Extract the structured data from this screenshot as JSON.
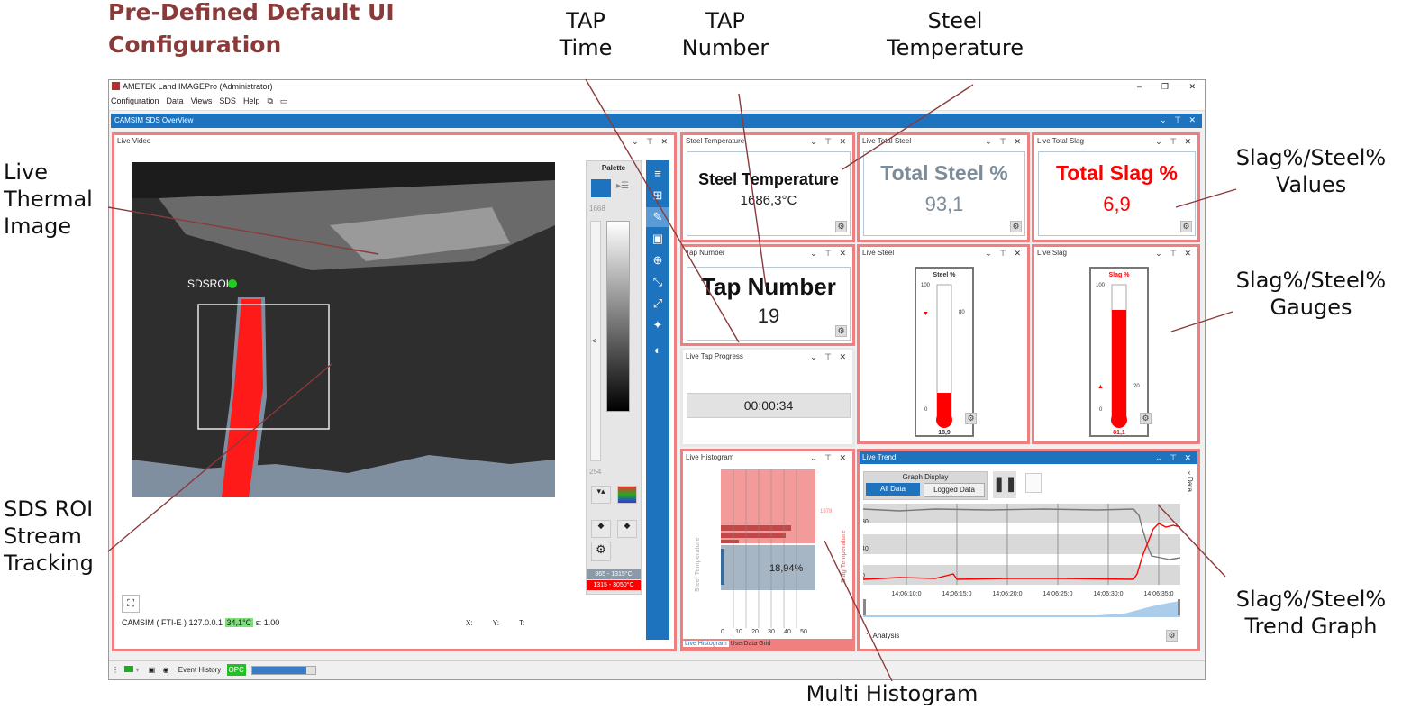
{
  "heading": "Pre-Defined Default UI\nConfiguration",
  "callouts": {
    "tap_time": "TAP\nTime",
    "tap_number": "TAP\nNumber",
    "steel_temperature": "Steel\nTemperature",
    "live_thermal": "Live\nThermal\nImage",
    "slag_values": "Slag%/Steel%\nValues",
    "slag_gauges": "Slag%/Steel%\nGauges",
    "sds_roi": "SDS ROI\nStream\nTracking",
    "trend_graph": "Slag%/Steel%\nTrend Graph",
    "multi_histogram": "Multi Histogram"
  },
  "window": {
    "title": "AMETEK Land IMAGEPro (Administrator)",
    "menu": [
      "Configuration",
      "Data",
      "Views",
      "SDS",
      "Help"
    ],
    "doc_tab": "CAMSIM SDS OverView",
    "win_controls": {
      "minimize": "–",
      "restore": "❐",
      "close": "✕"
    }
  },
  "panel_controls": "⌄ ⊤ ✕",
  "live_video": {
    "title": "Live Video",
    "roi_label": "SDSROI",
    "palette_title": "Palette",
    "palette_top_value": "1668",
    "palette_bottom_value": "254",
    "collapse_glyph": "<",
    "legend": [
      {
        "label": "865 - 1315°C",
        "color": "#8a9aa8"
      },
      {
        "label": "1315 - 3050°C",
        "color": "#ff0000"
      }
    ],
    "status_device": "CAMSIM ( FTI-E ) 127.0.0.1",
    "status_temp": "34,1°C",
    "status_emissivity": "ε: 1.00",
    "coords": {
      "x": "X:",
      "y": "Y:",
      "t": "T:"
    }
  },
  "steel_temperature": {
    "title": "Steel Temperature",
    "label": "Steel Temperature",
    "value": "1686,3°C"
  },
  "live_total_steel": {
    "title": "Live Total Steel",
    "label": "Total Steel %",
    "value": "93,1"
  },
  "live_total_slag": {
    "title": "Live Total Slag",
    "label": "Total Slag %",
    "value": "6,9"
  },
  "tap_number": {
    "title": "Tap Number",
    "label": "Tap Number",
    "value": "19"
  },
  "live_tap_progress": {
    "title": "Live Tap Progress",
    "value": "00:00:34"
  },
  "live_steel": {
    "title": "Live Steel",
    "gauge_title": "Steel %",
    "max": "100",
    "min": "0",
    "marker": "80",
    "value": "18,9",
    "fraction": 0.189,
    "color": "#ff0000"
  },
  "live_slag": {
    "title": "Live Slag",
    "gauge_title": "Slag %",
    "max": "100",
    "min": "0",
    "marker": "20",
    "value": "81,1",
    "fraction": 0.811,
    "color": "#ff0000"
  },
  "live_histogram": {
    "title": "Live Histogram",
    "ylabel_left": "Steel Temperature",
    "ylabel_right": "Slag Temperature",
    "right_value": "1979",
    "overlay_value": "18,94%",
    "x_ticks": [
      "0",
      "10",
      "20",
      "30",
      "40",
      "50"
    ],
    "tabs": [
      "Live Histogram",
      "UserData Grid"
    ]
  },
  "live_trend": {
    "title": "Live Trend",
    "graph_display": "Graph Display",
    "buttons": [
      "All Data",
      "Logged Data"
    ],
    "side_label": "Data",
    "y_ticks": [
      "80",
      "40",
      "0"
    ],
    "x_ticks": [
      "14:06:10:0",
      "14:06:15:0",
      "14:06:20:0",
      "14:06:25:0",
      "14:06:30:0",
      "14:06:35:0"
    ],
    "analysis": "Analysis",
    "colors": {
      "steel": "#777777",
      "slag": "#ff0000"
    }
  },
  "statusbar": {
    "event_history": "Event History",
    "opc": "OPC"
  }
}
